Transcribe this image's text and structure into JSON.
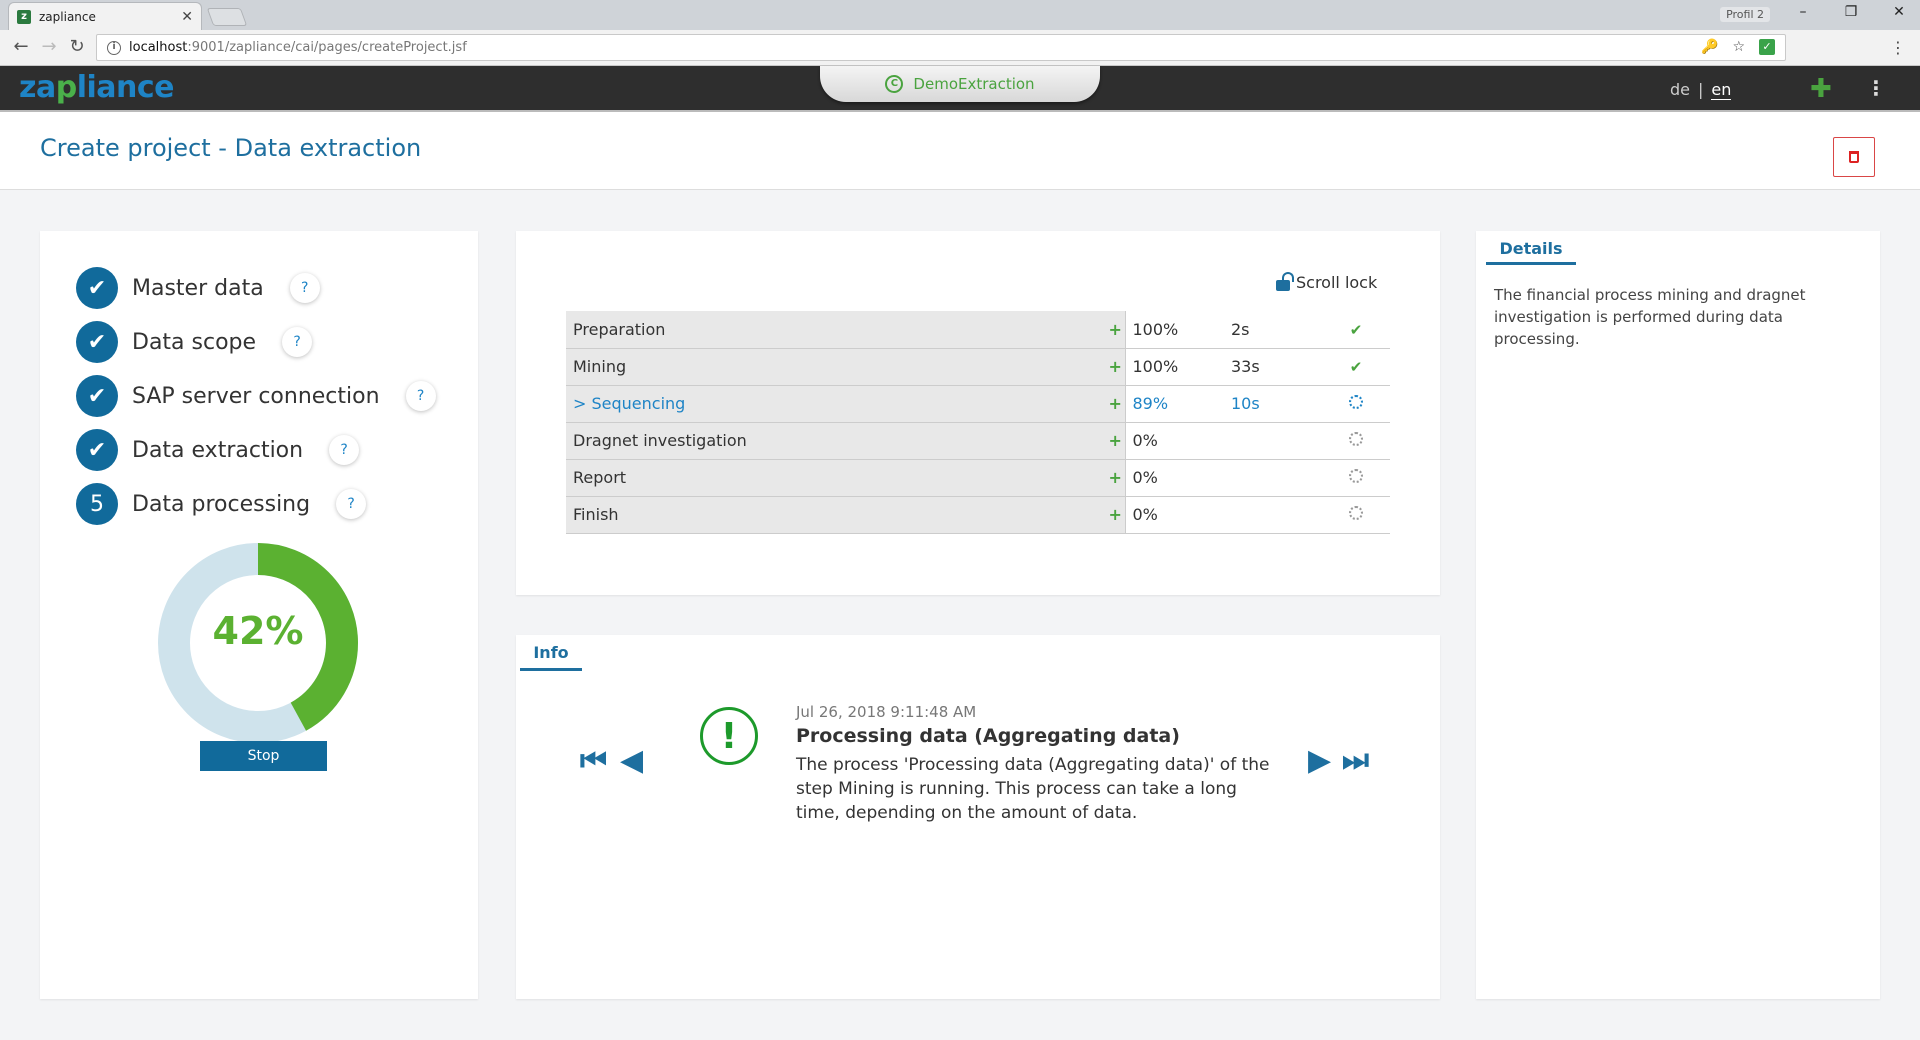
{
  "browser": {
    "tab_title": "zapliance",
    "tab_close": "✕",
    "profile": "Profil 2",
    "url_host": "localhost",
    "url_path": ":9001/zapliance/cai/pages/createProject.jsf"
  },
  "app": {
    "logo_za": "za",
    "logo_p": "p",
    "logo_rest": "liance",
    "project_name": "DemoExtraction",
    "lang_de": "de",
    "lang_sep": "|",
    "lang_en": "en"
  },
  "page": {
    "title": "Create project - Data extraction"
  },
  "steps": [
    {
      "marker": "✔",
      "label": "Master data",
      "help": "?"
    },
    {
      "marker": "✔",
      "label": "Data scope",
      "help": "?"
    },
    {
      "marker": "✔",
      "label": "SAP server connection",
      "help": "?"
    },
    {
      "marker": "✔",
      "label": "Data extraction",
      "help": "?"
    },
    {
      "marker": "5",
      "label": "Data processing",
      "help": "?"
    }
  ],
  "progress": {
    "percent_label": "42%",
    "percent_value": 0.42,
    "stop_label": "Stop",
    "ring_color": "#5bb131",
    "ring_bg_color": "#cfe3ec"
  },
  "phases": {
    "scroll_lock_label": "Scroll lock",
    "rows": [
      {
        "name": "Preparation",
        "plus": "+",
        "percent": "100%",
        "time": "2s",
        "status": "done"
      },
      {
        "name": "Mining",
        "plus": "+",
        "percent": "100%",
        "time": "33s",
        "status": "done"
      },
      {
        "name": "> Sequencing",
        "plus": "+",
        "percent": "89%",
        "time": "10s",
        "status": "running"
      },
      {
        "name": "Dragnet investigation",
        "plus": "+",
        "percent": "0%",
        "time": "",
        "status": "pending"
      },
      {
        "name": "Report",
        "plus": "+",
        "percent": "0%",
        "time": "",
        "status": "pending"
      },
      {
        "name": "Finish",
        "plus": "+",
        "percent": "0%",
        "time": "",
        "status": "pending"
      }
    ]
  },
  "info": {
    "tab_label": "Info",
    "timestamp": "Jul 26, 2018 9:11:48 AM",
    "title": "Processing data (Aggregating data)",
    "body": "The process 'Processing data (Aggregating data)' of the step Mining is running. This process can take a long time, depending on the amount of data.",
    "alert_glyph": "!"
  },
  "details": {
    "tab_label": "Details",
    "text": "The financial process mining and dragnet investigation is performed during data processing."
  }
}
